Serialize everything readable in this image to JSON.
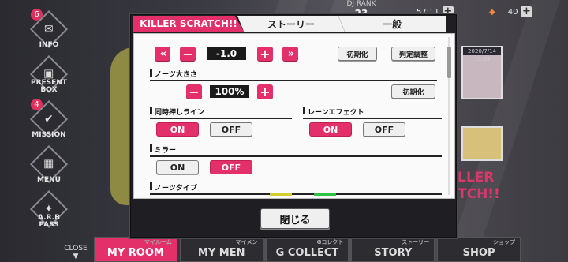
{
  "background": {
    "side_menu": [
      {
        "label": "INFO",
        "badge": "6",
        "icon": "mail-icon"
      },
      {
        "label": "PRESENT\nBOX",
        "badge": "",
        "icon": "gift-icon"
      },
      {
        "label": "MISSION",
        "badge": "4",
        "icon": "check-icon"
      },
      {
        "label": "MENU",
        "badge": "",
        "icon": "grid-icon"
      },
      {
        "label": "A.R.B\nPASS",
        "badge": "",
        "icon": "ticket-icon"
      }
    ],
    "dj_rank_label": "DJ RANK",
    "dj_rank_value": "23",
    "time_value": "57:11",
    "gem_value": "40",
    "card_date": "2020/7/14 10:59",
    "promo_text": "LLER\nTCH!!",
    "close_label": "CLOSE",
    "bottom_nav": [
      {
        "label": "MY ROOM",
        "sub": "マイルーム",
        "active": true
      },
      {
        "label": "MY MEN",
        "sub": "マイメン",
        "active": false
      },
      {
        "label": "G COLLECT",
        "sub": "Gコレクト",
        "active": false
      },
      {
        "label": "STORY",
        "sub": "ストーリー",
        "active": false
      },
      {
        "label": "SHOP",
        "sub": "ショップ",
        "active": false
      }
    ]
  },
  "dialog": {
    "tabs": {
      "killer": "KILLER SCRATCH!!",
      "story": "ストーリー",
      "general": "一般"
    },
    "timing": {
      "value": "-1.0",
      "reset_label": "初期化",
      "judge_label": "判定調整"
    },
    "notes_size": {
      "title": "ノーツ大きさ",
      "value": "100%",
      "reset_label": "初期化"
    },
    "simultaneous_line": {
      "title": "同時押しライン",
      "on_label": "ON",
      "off_label": "OFF",
      "selected": "ON"
    },
    "lane_effect": {
      "title": "レーンエフェクト",
      "on_label": "ON",
      "off_label": "OFF",
      "selected": "ON"
    },
    "mirror": {
      "title": "ミラー",
      "on_label": "ON",
      "off_label": "OFF",
      "selected": "OFF"
    },
    "notes_type": {
      "title": "ノーツタイプ"
    },
    "close_label": "閉じる",
    "colors": {
      "accent": "#e3306a"
    }
  }
}
